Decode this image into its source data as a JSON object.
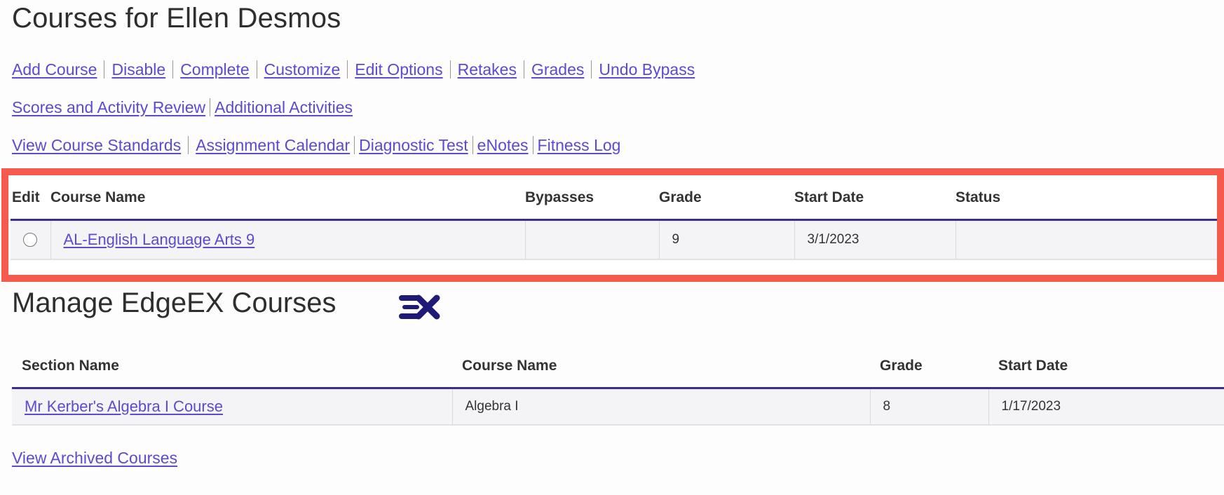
{
  "header": {
    "title": "Courses for Ellen Desmos"
  },
  "actions": {
    "row1": [
      "Add Course",
      "Disable",
      "Complete",
      "Customize",
      "Edit Options",
      "Retakes",
      "Grades",
      "Undo Bypass"
    ],
    "row2": [
      "Scores and Activity Review",
      "Additional Activities"
    ],
    "row3": [
      "View Course Standards",
      "Assignment Calendar",
      "Diagnostic Test",
      "eNotes",
      "Fitness Log"
    ]
  },
  "courses_table": {
    "headers": [
      "Edit",
      "Course Name",
      "Bypasses",
      "Grade",
      "Start Date",
      "Status"
    ],
    "rows": [
      {
        "selected": false,
        "course_name": "AL-English Language Arts 9",
        "bypasses": "",
        "grade": "9",
        "start_date": "3/1/2023",
        "status": ""
      }
    ]
  },
  "edgeex": {
    "title": "Manage EdgeEX Courses",
    "logo": "edgeex-logo-icon",
    "headers": [
      "Section Name",
      "Course Name",
      "Grade",
      "Start Date"
    ],
    "rows": [
      {
        "section_name": "Mr Kerber's Algebra I Course",
        "course_name": "Algebra I",
        "grade": "8",
        "start_date": "1/17/2023"
      }
    ]
  },
  "footer": {
    "archived_link": "View Archived Courses"
  },
  "colors": {
    "link": "#5a4bd0",
    "highlight": "#f65a4c",
    "header_rule": "#3c2d90",
    "logo": "#1f1a78"
  }
}
